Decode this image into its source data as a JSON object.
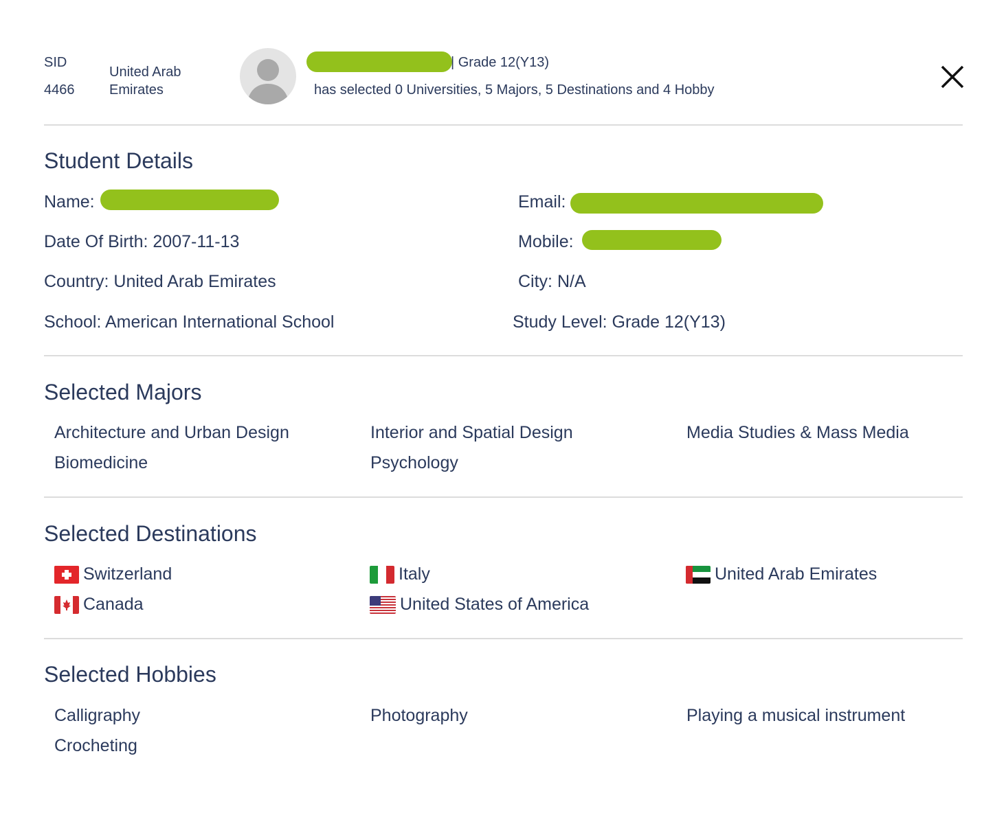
{
  "header": {
    "sid_label": "SID",
    "sid_value": "4466",
    "country_line1": "United Arab",
    "country_line2": "Emirates",
    "grade": "| Grade 12(Y13)",
    "summary": "has selected 0 Universities, 5 Majors, 5 Destinations and 4 Hobby"
  },
  "student_details": {
    "title": "Student Details",
    "name_label": "Name:",
    "email_label": "Email:",
    "dob": "Date Of Birth: 2007-11-13",
    "mobile_label": "Mobile:",
    "country": "Country: United Arab Emirates",
    "city": "City: N/A",
    "school": "School: American International School",
    "study_level": "Study Level: Grade 12(Y13)"
  },
  "majors": {
    "title": "Selected Majors",
    "items": [
      "Architecture and Urban Design",
      "Interior and Spatial Design",
      "Media Studies & Mass Media",
      "Biomedicine",
      "Psychology"
    ]
  },
  "destinations": {
    "title": "Selected Destinations",
    "items": [
      {
        "name": "Switzerland",
        "flag": "flag-switzerland-icon"
      },
      {
        "name": "Italy",
        "flag": "flag-italy-icon"
      },
      {
        "name": "United Arab Emirates",
        "flag": "flag-uae-icon"
      },
      {
        "name": "Canada",
        "flag": "flag-canada-icon"
      },
      {
        "name": "United States of America",
        "flag": "flag-usa-icon"
      }
    ]
  },
  "hobbies": {
    "title": "Selected Hobbies",
    "items": [
      "Calligraphy",
      "Photography",
      "Playing a musical instrument",
      "Crocheting"
    ]
  },
  "colors": {
    "text": "#2b3a5c",
    "redaction": "#93c11c",
    "divider": "#dcdcdc"
  }
}
